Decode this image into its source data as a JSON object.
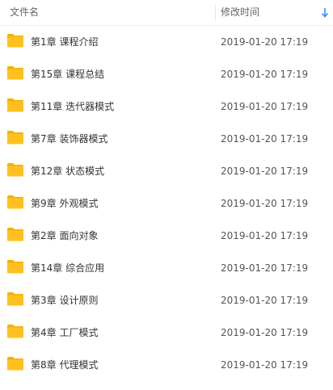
{
  "header": {
    "name_label": "文件名",
    "date_label": "修改时间",
    "sort_icon": "arrow-down-icon"
  },
  "folder_color": "#ffc11f",
  "folder_tab_color": "#f5b000",
  "accent": "#3b8cff",
  "files": [
    {
      "name": "第1章 课程介绍",
      "date": "2019-01-20 17:19"
    },
    {
      "name": "第15章 课程总结",
      "date": "2019-01-20 17:19"
    },
    {
      "name": "第11章 迭代器模式",
      "date": "2019-01-20 17:19"
    },
    {
      "name": "第7章 装饰器模式",
      "date": "2019-01-20 17:19"
    },
    {
      "name": "第12章 状态模式",
      "date": "2019-01-20 17:19"
    },
    {
      "name": "第9章 外观模式",
      "date": "2019-01-20 17:19"
    },
    {
      "name": "第2章 面向对象",
      "date": "2019-01-20 17:19"
    },
    {
      "name": "第14章 综合应用",
      "date": "2019-01-20 17:19"
    },
    {
      "name": "第3章 设计原则",
      "date": "2019-01-20 17:19"
    },
    {
      "name": "第4章 工厂模式",
      "date": "2019-01-20 17:19"
    },
    {
      "name": "第8章 代理模式",
      "date": "2019-01-20 17:19"
    }
  ]
}
